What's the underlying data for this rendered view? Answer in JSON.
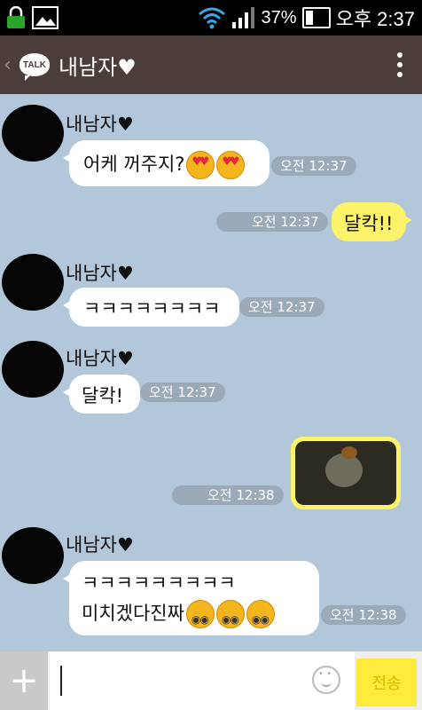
{
  "status_bar": {
    "battery": "37%",
    "time": "오후 2:37"
  },
  "header": {
    "back": "‹",
    "logo": "TALK",
    "title": "내남자♥",
    "menu_icon": "kebab-icon"
  },
  "messages": [
    {
      "sender": "내남자♥",
      "text": "어케 꺼주지?",
      "time": "오전 12:37"
    },
    {
      "out_text": "달칵!!",
      "time": "오전 12:37"
    },
    {
      "sender": "내남자♥",
      "text": "ㅋㅋㅋㅋㅋㅋㅋㅋ",
      "time": "오전 12:37"
    },
    {
      "sender": "내남자♥",
      "text": "달칵!",
      "time": "오전 12:37"
    },
    {
      "photo": "photo-icon",
      "time": "오전 12:38"
    },
    {
      "sender": "내남자♥",
      "text_line1": "ㅋㅋㅋㅋㅋㅋㅋㅋㅋ",
      "text_line2": "미치겠다진짜",
      "time": "오전 12:38"
    }
  ],
  "input": {
    "plus": "+",
    "send_label": "전송"
  }
}
